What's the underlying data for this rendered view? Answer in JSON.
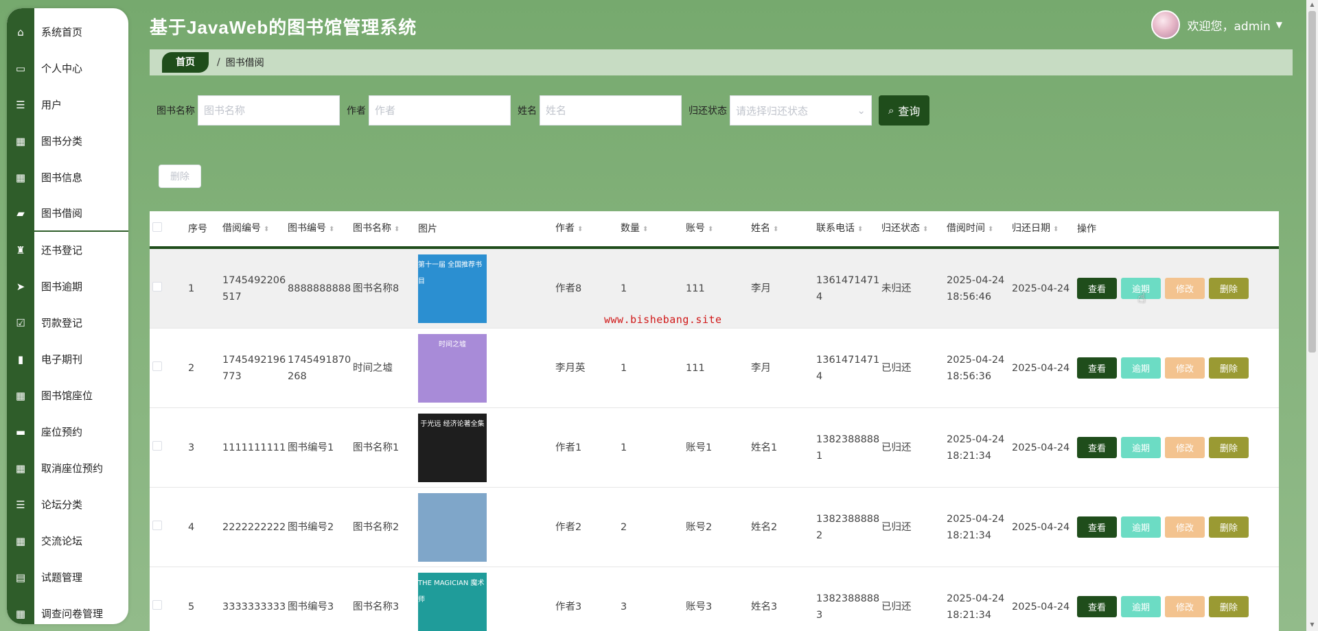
{
  "app": {
    "title": "基于JavaWeb的图书馆管理系统",
    "user_greeting": "欢迎您，admin"
  },
  "colors": {
    "primary": "#1f4d1b",
    "sidebar_rail": "#2f5d2a",
    "renew": "#6cdcc4",
    "edit": "#f3c38f",
    "delete": "#9a9a33",
    "watermark": "#d01818"
  },
  "sidebar": {
    "items": [
      {
        "label": "系统首页",
        "icon": "home-icon",
        "glyph": "⌂"
      },
      {
        "label": "个人中心",
        "icon": "profile-card-icon",
        "glyph": "▭"
      },
      {
        "label": "用户",
        "icon": "list-icon",
        "glyph": "☰"
      },
      {
        "label": "图书分类",
        "icon": "grid-icon",
        "glyph": "▦"
      },
      {
        "label": "图书信息",
        "icon": "grid-icon",
        "glyph": "▦"
      },
      {
        "label": "图书借阅",
        "icon": "briefcase-icon",
        "glyph": "▰"
      },
      {
        "label": "还书登记",
        "icon": "stamp-icon",
        "glyph": "♜"
      },
      {
        "label": "图书逾期",
        "icon": "send-icon",
        "glyph": "➤"
      },
      {
        "label": "罚款登记",
        "icon": "clipboard-check-icon",
        "glyph": "☑"
      },
      {
        "label": "电子期刊",
        "icon": "book-icon",
        "glyph": "▮"
      },
      {
        "label": "图书馆座位",
        "icon": "grid-icon",
        "glyph": "▦"
      },
      {
        "label": "座位预约",
        "icon": "ticket-icon",
        "glyph": "▬"
      },
      {
        "label": "取消座位预约",
        "icon": "grid-icon",
        "glyph": "▦"
      },
      {
        "label": "论坛分类",
        "icon": "list-icon",
        "glyph": "☰"
      },
      {
        "label": "交流论坛",
        "icon": "grid-icon",
        "glyph": "▦"
      },
      {
        "label": "试题管理",
        "icon": "clipboard-icon",
        "glyph": "▤"
      },
      {
        "label": "调查问卷管理",
        "icon": "grid-icon",
        "glyph": "▦"
      }
    ]
  },
  "breadcrumb": {
    "home": "首页",
    "separator": "/",
    "current": "图书借阅"
  },
  "search": {
    "book_name_label": "图书名称",
    "book_name_placeholder": "图书名称",
    "author_label": "作者",
    "author_placeholder": "作者",
    "name_label": "姓名",
    "name_placeholder": "姓名",
    "status_label": "归还状态",
    "status_placeholder": "请选择归还状态",
    "button": "查询"
  },
  "toolbar": {
    "delete_label": "删除"
  },
  "table": {
    "headers": {
      "idx": "序号",
      "borrow_no": "借阅编号",
      "book_no": "图书编号",
      "book_name": "图书名称",
      "image": "图片",
      "author": "作者",
      "qty": "数量",
      "account": "账号",
      "name": "姓名",
      "phone": "联系电话",
      "status": "归还状态",
      "borrow_time": "借阅时间",
      "return_date": "归还日期",
      "ops": "操作"
    },
    "op_labels": {
      "view": "查看",
      "renew": "逾期",
      "edit": "修改",
      "delete": "删除"
    },
    "rows": [
      {
        "idx": "1",
        "borrow_no": "1745492206517",
        "book_no": "8888888888",
        "book_name": "图书名称8",
        "cover_text": "第十一届 全国推荐书目",
        "cover_color": "#2b8fd1",
        "author": "作者8",
        "qty": "1",
        "account": "111",
        "name": "李月",
        "phone": "13614714714",
        "status": "未归还",
        "borrow_time": "2025-04-24 18:56:46",
        "return_date": "2025-04-24"
      },
      {
        "idx": "2",
        "borrow_no": "1745492196773",
        "book_no": "1745491870268",
        "book_name": "时间之墟",
        "cover_text": "时间之墟",
        "cover_color": "#a88bd8",
        "author": "李月英",
        "qty": "1",
        "account": "111",
        "name": "李月",
        "phone": "13614714714",
        "status": "已归还",
        "borrow_time": "2025-04-24 18:56:36",
        "return_date": "2025-04-24"
      },
      {
        "idx": "3",
        "borrow_no": "1111111111",
        "book_no": "图书编号1",
        "book_name": "图书名称1",
        "cover_text": "于光远 经济论著全集",
        "cover_color": "#1e1e1e",
        "author": "作者1",
        "qty": "1",
        "account": "账号1",
        "name": "姓名1",
        "phone": "13823888881",
        "status": "已归还",
        "borrow_time": "2025-04-24 18:21:34",
        "return_date": "2025-04-24"
      },
      {
        "idx": "4",
        "borrow_no": "2222222222",
        "book_no": "图书编号2",
        "book_name": "图书名称2",
        "cover_text": "",
        "cover_color": "#7fa6c9",
        "author": "作者2",
        "qty": "2",
        "account": "账号2",
        "name": "姓名2",
        "phone": "13823888882",
        "status": "已归还",
        "borrow_time": "2025-04-24 18:21:34",
        "return_date": "2025-04-24"
      },
      {
        "idx": "5",
        "borrow_no": "3333333333",
        "book_no": "图书编号3",
        "book_name": "图书名称3",
        "cover_text": "THE MAGICIAN 魔术师",
        "cover_color": "#1f9c9a",
        "author": "作者3",
        "qty": "3",
        "account": "账号3",
        "name": "姓名3",
        "phone": "13823888883",
        "status": "已归还",
        "borrow_time": "2025-04-24 18:21:34",
        "return_date": "2025-04-24"
      }
    ]
  },
  "watermark": "www.bishebang.site"
}
